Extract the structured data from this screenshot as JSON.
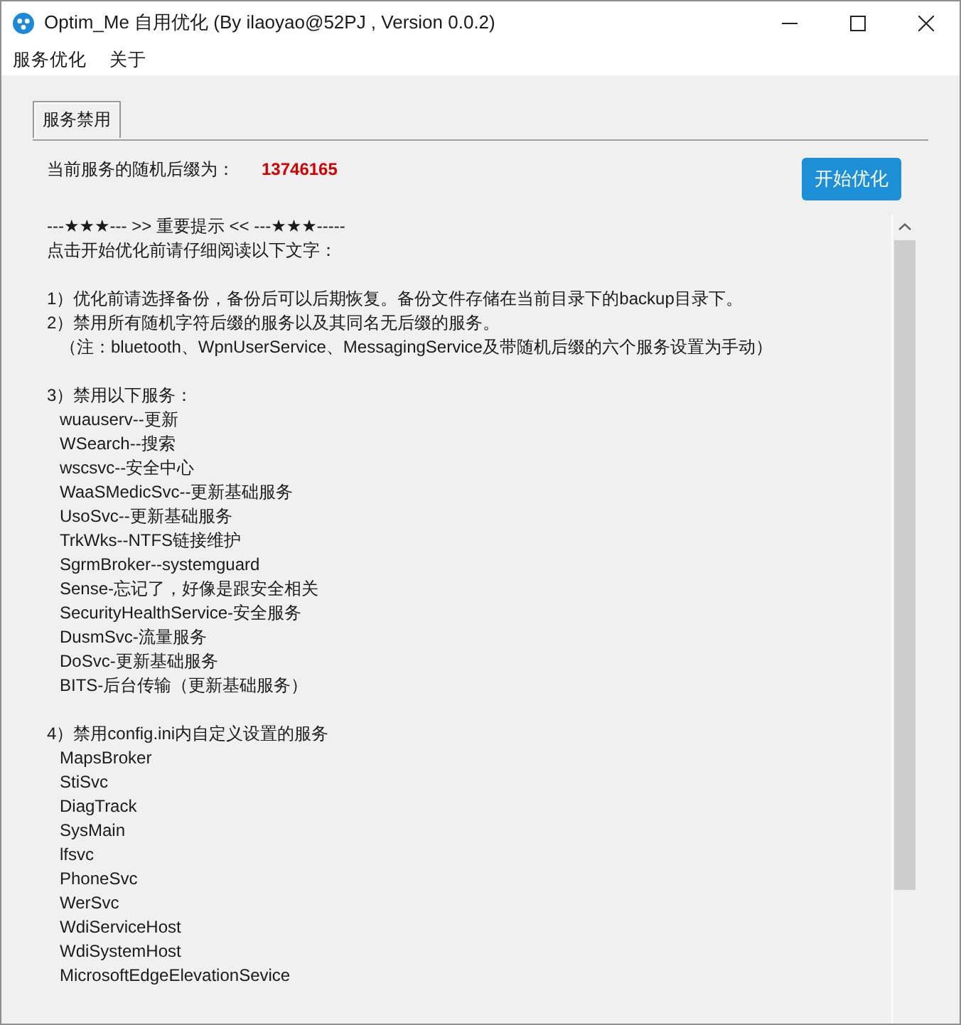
{
  "window": {
    "title": "Optim_Me 自用优化 (By ilaoyao@52PJ , Version 0.0.2)"
  },
  "menu_bar": {
    "items": [
      "服务优化",
      "关于"
    ]
  },
  "tabs": [
    {
      "label": "服务禁用",
      "selected": true
    }
  ],
  "suffix": {
    "label": "当前服务的随机后缀为：",
    "value": "13746165"
  },
  "start_button": {
    "label": "开始优化"
  },
  "notice": {
    "blocks": [
      {
        "lines": [
          {
            "kind": "plain",
            "text": "---★★★--- >> 重要提示 << ---★★★-----"
          },
          {
            "kind": "plain",
            "text": "点击开始优化前请仔细阅读以下文字："
          }
        ]
      },
      {
        "lines": [
          {
            "kind": "plain",
            "text": "1）优化前请选择备份，备份后可以后期恢复。备份文件存储在当前目录下的backup目录下。"
          },
          {
            "kind": "plain",
            "text": "2）禁用所有随机字符后缀的服务以及其同名无后缀的服务。"
          },
          {
            "kind": "indented",
            "text": "（注：bluetooth、WpnUserService、MessagingService及带随机后缀的六个服务设置为手动）"
          }
        ]
      },
      {
        "lines": [
          {
            "kind": "plain",
            "text": "3）禁用以下服务："
          },
          {
            "kind": "indented",
            "text": "wuauserv--更新"
          },
          {
            "kind": "indented",
            "text": "WSearch--搜索"
          },
          {
            "kind": "indented",
            "text": "wscsvc--安全中心"
          },
          {
            "kind": "indented",
            "text": "WaaSMedicSvc--更新基础服务"
          },
          {
            "kind": "indented",
            "text": "UsoSvc--更新基础服务"
          },
          {
            "kind": "indented",
            "text": "TrkWks--NTFS链接维护"
          },
          {
            "kind": "indented",
            "text": "SgrmBroker--systemguard"
          },
          {
            "kind": "indented",
            "text": "Sense-忘记了，好像是跟安全相关"
          },
          {
            "kind": "indented",
            "text": "SecurityHealthService-安全服务"
          },
          {
            "kind": "indented",
            "text": "DusmSvc-流量服务"
          },
          {
            "kind": "indented",
            "text": "DoSvc-更新基础服务"
          },
          {
            "kind": "indented",
            "text": "BITS-后台传输（更新基础服务）"
          }
        ]
      },
      {
        "lines": [
          {
            "kind": "plain",
            "text": "4）禁用config.ini内自定义设置的服务"
          },
          {
            "kind": "indented",
            "text": "MapsBroker"
          },
          {
            "kind": "indented",
            "text": "StiSvc"
          },
          {
            "kind": "indented",
            "text": "DiagTrack"
          },
          {
            "kind": "indented",
            "text": "SysMain"
          },
          {
            "kind": "indented",
            "text": "lfsvc"
          },
          {
            "kind": "indented",
            "text": "PhoneSvc"
          },
          {
            "kind": "indented",
            "text": "WerSvc"
          },
          {
            "kind": "indented",
            "text": "WdiServiceHost"
          },
          {
            "kind": "indented",
            "text": "WdiSystemHost"
          },
          {
            "kind": "indented",
            "text": "MicrosoftEdgeElevationSevice"
          }
        ]
      }
    ]
  }
}
